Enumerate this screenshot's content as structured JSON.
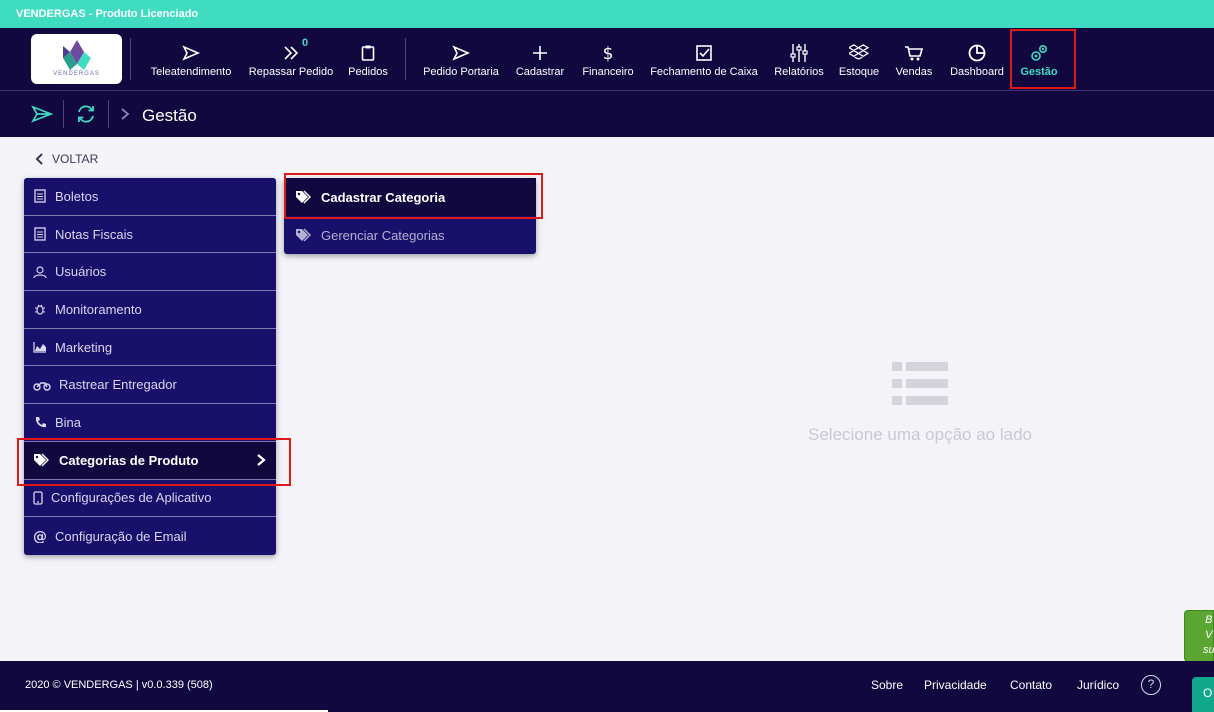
{
  "topbar": {
    "title": "VENDERGAS - Produto Licenciado"
  },
  "logo": {
    "text": "VENDERGAS"
  },
  "nav": {
    "items": [
      {
        "label": "Teleatendimento",
        "icon": "send-icon"
      },
      {
        "label": "Repassar Pedido",
        "icon": "double-chevron-icon",
        "badge": "0"
      },
      {
        "label": "Pedidos",
        "icon": "clipboard-icon"
      },
      {
        "label": "Pedido Portaria",
        "icon": "send-icon"
      },
      {
        "label": "Cadastrar",
        "icon": "plus-icon"
      },
      {
        "label": "Financeiro",
        "icon": "dollar-icon"
      },
      {
        "label": "Fechamento de Caixa",
        "icon": "checkbox-icon"
      },
      {
        "label": "Relatórios",
        "icon": "sliders-icon"
      },
      {
        "label": "Estoque",
        "icon": "dropbox-icon"
      },
      {
        "label": "Vendas",
        "icon": "cart-icon"
      },
      {
        "label": "Dashboard",
        "icon": "pie-chart-icon"
      },
      {
        "label": "Gestão",
        "icon": "gears-icon",
        "active": true
      }
    ]
  },
  "breadcrumb": {
    "title": "Gestão"
  },
  "back": {
    "label": "VOLTAR"
  },
  "menu": {
    "items": [
      {
        "label": "Boletos",
        "icon": "document-icon"
      },
      {
        "label": "Notas Fiscais",
        "icon": "document-icon"
      },
      {
        "label": "Usuários",
        "icon": "users-icon"
      },
      {
        "label": "Monitoramento",
        "icon": "bug-icon"
      },
      {
        "label": "Marketing",
        "icon": "area-chart-icon"
      },
      {
        "label": "Rastrear Entregador",
        "icon": "motorcycle-icon"
      },
      {
        "label": "Bina",
        "icon": "phone-icon"
      },
      {
        "label": "Categorias de Produto",
        "icon": "tags-icon",
        "active": true
      },
      {
        "label": "Configurações de Aplicativo",
        "icon": "mobile-icon"
      },
      {
        "label": "Configuração de Email",
        "icon": "at-icon"
      }
    ]
  },
  "submenu": {
    "items": [
      {
        "label": "Cadastrar Categoria",
        "icon": "tags-icon"
      },
      {
        "label": "Gerenciar Categorias",
        "icon": "tags-icon"
      }
    ]
  },
  "empty_state": {
    "text": "Selecione uma opção ao lado"
  },
  "footer": {
    "copyright": "2020 © VENDERGAS | v0.0.339 (508)",
    "links": [
      "Sobre",
      "Privacidade",
      "Contato",
      "Jurídico"
    ],
    "help": "?"
  },
  "floating": {
    "green_button": "B\nV\nsu",
    "teal_button": "O"
  },
  "colors": {
    "topbar": "#3fdcc2",
    "header": "#10083f",
    "menu": "#18106a",
    "accent": "#3fdcc2",
    "highlight": "#e01818",
    "background": "#f3f3f8"
  }
}
